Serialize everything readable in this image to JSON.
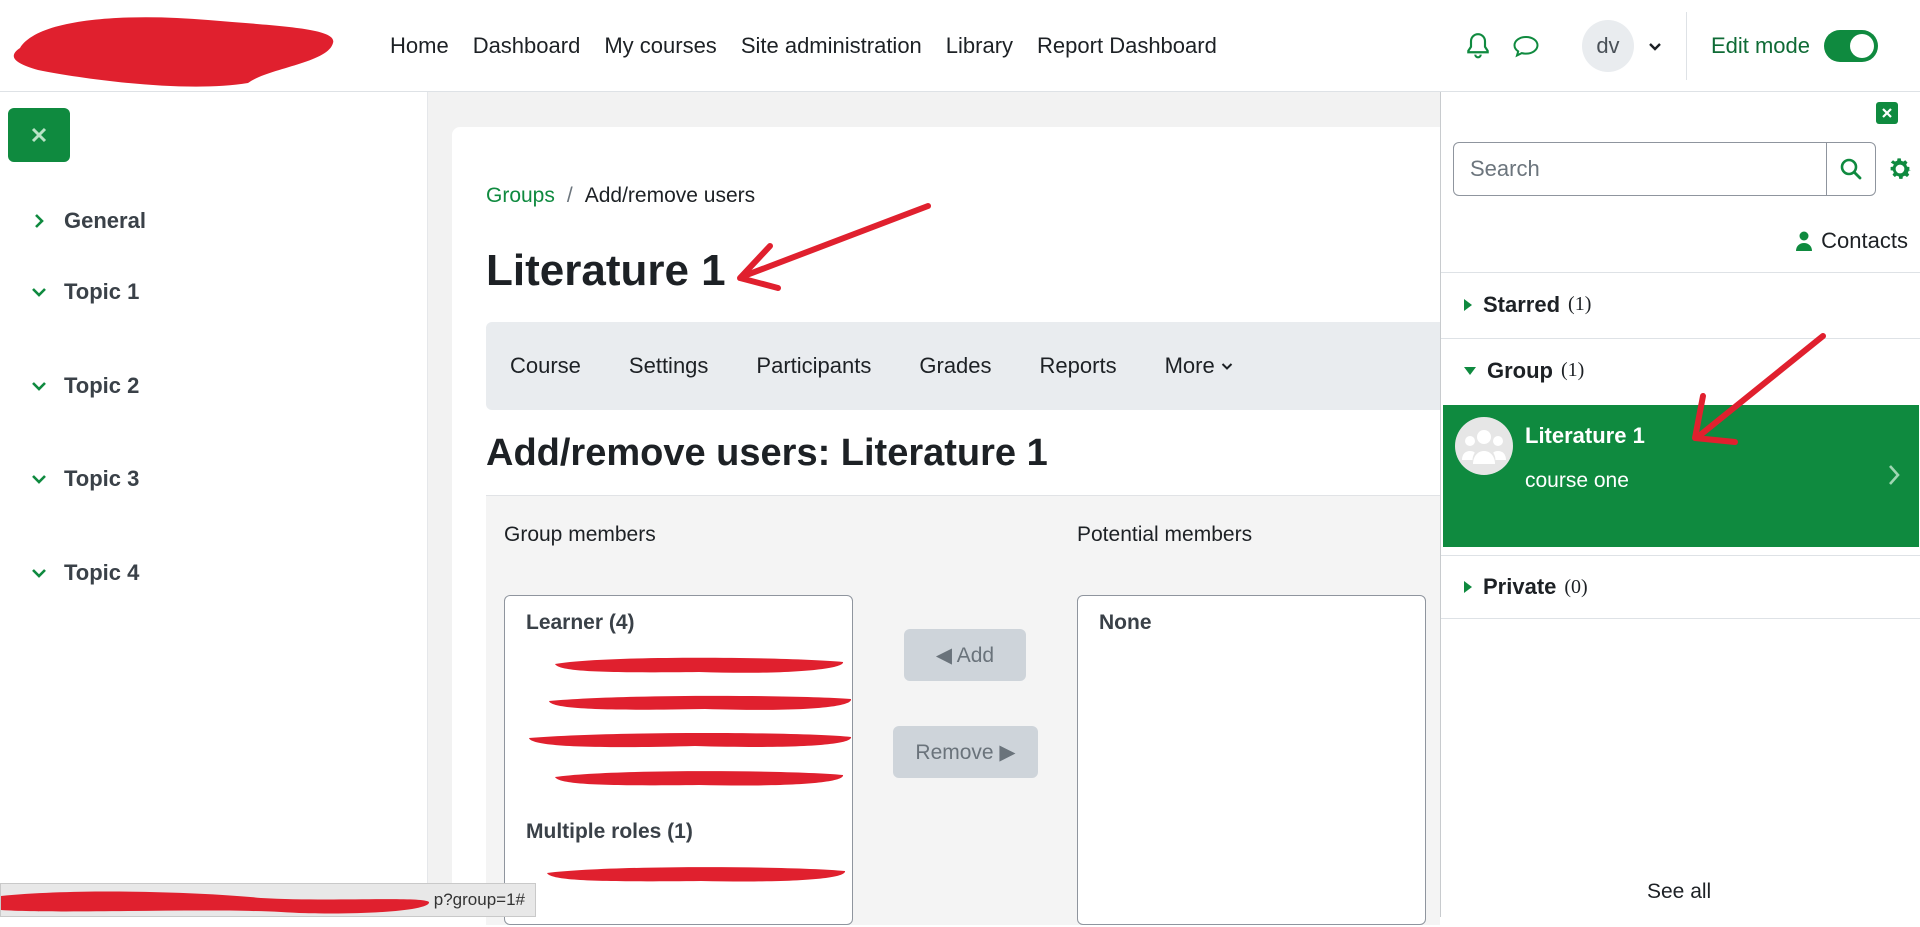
{
  "navbar": {
    "links": [
      "Home",
      "Dashboard",
      "My courses",
      "Site administration",
      "Library",
      "Report Dashboard"
    ],
    "user_initials": "dv",
    "edit_mode_label": "Edit mode",
    "edit_mode_on": true
  },
  "course_index": {
    "sections": [
      {
        "label": "General",
        "expanded": false
      },
      {
        "label": "Topic 1",
        "expanded": true
      },
      {
        "label": "Topic 2",
        "expanded": true
      },
      {
        "label": "Topic 3",
        "expanded": true
      },
      {
        "label": "Topic 4",
        "expanded": true
      }
    ]
  },
  "breadcrumb": {
    "parent": "Groups",
    "current": "Add/remove users"
  },
  "page": {
    "title": "Literature 1",
    "heading": "Add/remove users: Literature 1"
  },
  "secondary_nav": {
    "tabs": [
      "Course",
      "Settings",
      "Participants",
      "Grades",
      "Reports",
      "More"
    ]
  },
  "members_form": {
    "group_members_label": "Group members",
    "potential_members_label": "Potential members",
    "group_members_groups": [
      "Learner (4)",
      "Multiple roles (1)"
    ],
    "potential_members_empty": "None",
    "add_label": "◀ Add",
    "remove_label": "Remove ▶"
  },
  "message_drawer": {
    "search_placeholder": "Search",
    "contacts_label": "Contacts",
    "sections": {
      "starred": {
        "label": "Starred",
        "count": "(1)"
      },
      "group": {
        "label": "Group",
        "count": "(1)"
      },
      "private": {
        "label": "Private",
        "count": "(0)"
      }
    },
    "group_conversation": {
      "name": "Literature 1",
      "subtitle": "course one"
    },
    "see_all": "See all"
  },
  "status_bar": {
    "url_suffix": "p?group=1#"
  },
  "colors": {
    "brand_green": "#0f8a3f",
    "link_green": "#0f8a3f",
    "annotation_red": "#e0202e"
  }
}
